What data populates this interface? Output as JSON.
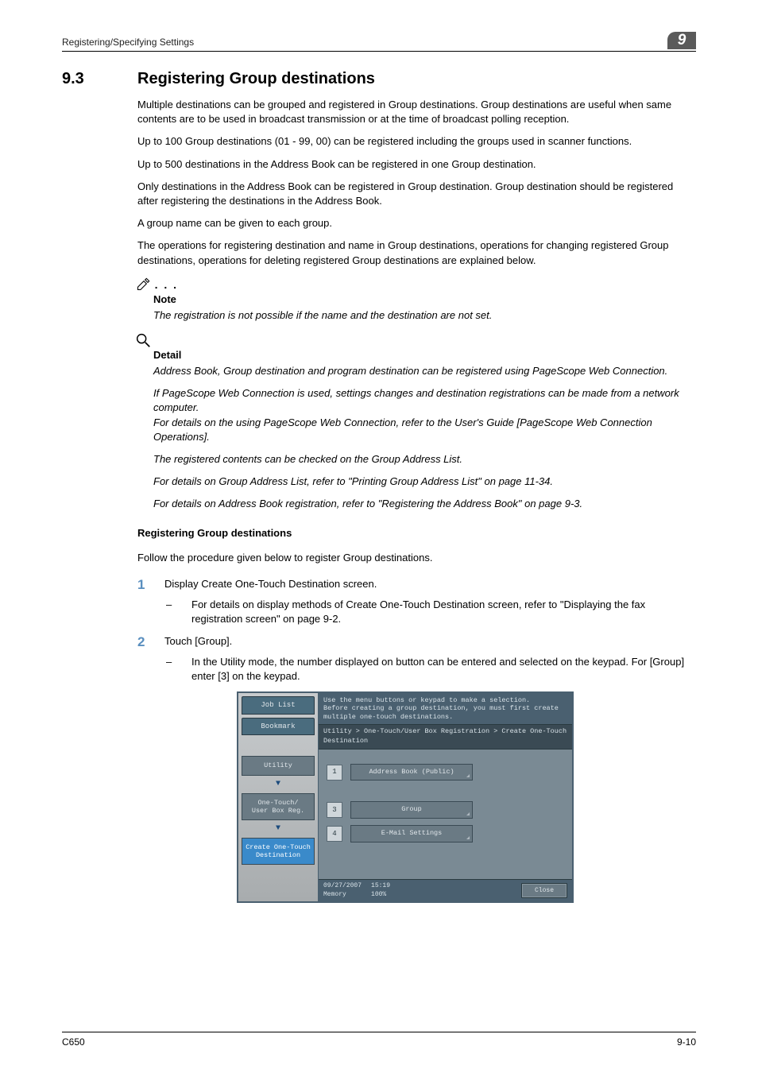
{
  "header": {
    "left": "Registering/Specifying Settings",
    "badge": "9"
  },
  "section": {
    "number": "9.3",
    "title": "Registering Group destinations"
  },
  "paras": {
    "p1": "Multiple destinations can be grouped and registered in Group destinations. Group destinations are useful when same contents are to be used in broadcast transmission or at the time of broadcast polling reception.",
    "p2": "Up to 100 Group destinations (01 - 99, 00) can be registered including the groups used in scanner functions.",
    "p3": "Up to 500 destinations in the Address Book can be registered in one Group destination.",
    "p4": "Only destinations in the Address Book can be registered in Group destination. Group destination should be registered after registering the destinations in the Address Book.",
    "p5": "A group name can be given to each group.",
    "p6": "The operations for registering destination and name in Group destinations, operations for changing registered Group destinations, operations for deleting registered Group destinations are explained below."
  },
  "note": {
    "label": "Note",
    "text": "The registration is not possible if the name and the destination are not set."
  },
  "detail": {
    "label": "Detail",
    "d1": "Address Book, Group destination and program destination can be registered using PageScope Web Connection.",
    "d2a": "If PageScope Web Connection is used, settings changes and destination registrations can be made from a network computer.",
    "d2b": "For details on the using PageScope Web Connection, refer to the User's Guide [PageScope Web Connection Operations].",
    "d3": "The registered contents can be checked on the Group Address List.",
    "d4": "For details on Group Address List, refer to \"Printing Group Address List\" on page 11-34.",
    "d5": "For details on Address Book registration, refer to \"Registering the Address Book\" on page 9-3."
  },
  "sub": {
    "heading": "Registering Group destinations",
    "intro": "Follow the procedure given below to register Group destinations."
  },
  "steps": {
    "s1": {
      "num": "1",
      "text": "Display Create One-Touch Destination screen.",
      "sub": "For details on display methods of Create One-Touch Destination screen, refer to \"Displaying the fax registration screen\" on page 9-2."
    },
    "s2": {
      "num": "2",
      "text": "Touch [Group].",
      "sub": "In the Utility mode, the number displayed on button can be entered and selected on the keypad. For [Group] enter [3] on the keypad."
    }
  },
  "ui": {
    "tabs": {
      "joblist": "Job List",
      "bookmark": "Bookmark"
    },
    "msg1": "Use the menu buttons or keypad to make a selection.",
    "msg2": "Before creating a group destination, you must first create multiple one-touch destinations.",
    "breadcrumb": "Utility > One-Touch/User Box Registration > Create One-Touch Destination",
    "nav": {
      "utility": "Utility",
      "onetouch": "One-Touch/\nUser Box Reg.",
      "create": "Create One-Touch\nDestination"
    },
    "options": [
      {
        "num": "1",
        "label": "Address Book (Public)"
      },
      {
        "num": "3",
        "label": "Group"
      },
      {
        "num": "4",
        "label": "E-Mail Settings"
      }
    ],
    "status": {
      "date": "09/27/2007",
      "time": "15:19",
      "memLabel": "Memory",
      "memVal": "100%",
      "close": "Close"
    }
  },
  "footer": {
    "left": "C650",
    "right": "9-10"
  }
}
